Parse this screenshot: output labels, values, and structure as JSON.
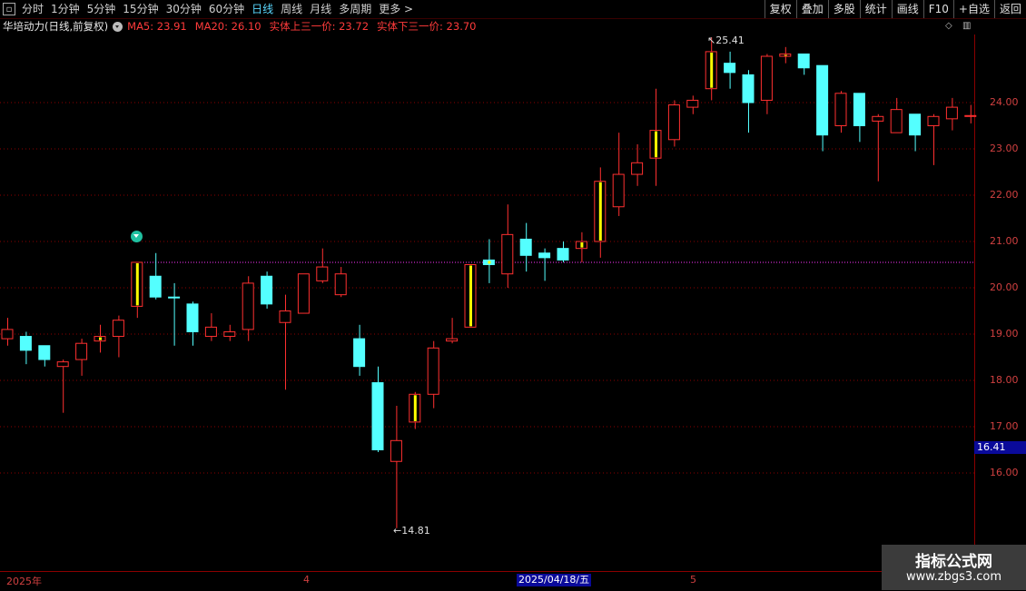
{
  "toolbar": {
    "periods": [
      "分时",
      "1分钟",
      "5分钟",
      "15分钟",
      "30分钟",
      "60分钟",
      "日线",
      "周线",
      "月线",
      "多周期",
      "更多 >"
    ],
    "active_period": "日线",
    "right_buttons": [
      "复权",
      "叠加",
      "多股",
      "统计",
      "画线",
      "F10",
      "+自选",
      "返回"
    ]
  },
  "info": {
    "stock_title": "华培动力(日线,前复权)",
    "indicators": [
      "MA5: 23.91",
      "MA20: 26.10",
      "实体上三一价: 23.72",
      "实体下三一价: 23.70"
    ]
  },
  "price_axis": {
    "labels": [
      "24.00",
      "23.00",
      "22.00",
      "21.00",
      "20.00",
      "19.00",
      "18.00",
      "17.00",
      "16.00"
    ],
    "current_price": "16.41"
  },
  "date_axis": {
    "labels": [
      "2025年",
      "4",
      "5"
    ],
    "selected": "2025/04/18/五"
  },
  "annotations": {
    "high": "25.41",
    "low": "14.81"
  },
  "watermark": {
    "line1": "指标公式网",
    "line2": "www.zbgs3.com"
  },
  "colors": {
    "up": "#ff3030",
    "down": "#54ffff",
    "highlight": "#ffff00",
    "grid": "#8b0000",
    "ref": "#ff33ff"
  },
  "chart_data": {
    "type": "candlestick",
    "ylim": [
      14.5,
      25.9
    ],
    "reference_line": 20.55,
    "candles": [
      {
        "o": 18.9,
        "h": 19.35,
        "l": 18.75,
        "c": 19.1,
        "k": "up"
      },
      {
        "o": 18.95,
        "h": 19.05,
        "l": 18.35,
        "c": 18.65,
        "k": "down"
      },
      {
        "o": 18.75,
        "h": 18.75,
        "l": 18.3,
        "c": 18.45,
        "k": "down"
      },
      {
        "o": 18.3,
        "h": 18.45,
        "l": 17.3,
        "c": 18.4,
        "k": "up"
      },
      {
        "o": 18.45,
        "h": 18.9,
        "l": 18.1,
        "c": 18.8,
        "k": "up"
      },
      {
        "o": 18.85,
        "h": 19.2,
        "l": 18.6,
        "c": 18.95,
        "k": "up",
        "hi": true
      },
      {
        "o": 18.95,
        "h": 19.4,
        "l": 18.5,
        "c": 19.3,
        "k": "up"
      },
      {
        "o": 19.6,
        "h": 20.55,
        "l": 19.35,
        "c": 20.55,
        "k": "up",
        "hi": true
      },
      {
        "o": 20.25,
        "h": 20.75,
        "l": 19.75,
        "c": 19.8,
        "k": "down"
      },
      {
        "o": 19.8,
        "h": 20.1,
        "l": 18.75,
        "c": 19.8,
        "k": "down"
      },
      {
        "o": 19.65,
        "h": 19.7,
        "l": 18.75,
        "c": 19.05,
        "k": "down"
      },
      {
        "o": 18.95,
        "h": 19.45,
        "l": 18.85,
        "c": 19.15,
        "k": "up"
      },
      {
        "o": 18.95,
        "h": 19.2,
        "l": 18.85,
        "c": 19.05,
        "k": "up"
      },
      {
        "o": 19.1,
        "h": 20.25,
        "l": 18.85,
        "c": 20.1,
        "k": "up"
      },
      {
        "o": 20.25,
        "h": 20.35,
        "l": 19.55,
        "c": 19.65,
        "k": "down"
      },
      {
        "o": 19.25,
        "h": 19.85,
        "l": 17.8,
        "c": 19.5,
        "k": "up"
      },
      {
        "o": 19.45,
        "h": 20.3,
        "l": 19.45,
        "c": 20.3,
        "k": "up"
      },
      {
        "o": 20.15,
        "h": 20.85,
        "l": 20.1,
        "c": 20.45,
        "k": "up"
      },
      {
        "o": 19.85,
        "h": 20.45,
        "l": 19.8,
        "c": 20.3,
        "k": "up"
      },
      {
        "o": 18.9,
        "h": 19.2,
        "l": 18.1,
        "c": 18.3,
        "k": "down"
      },
      {
        "o": 17.95,
        "h": 18.3,
        "l": 16.45,
        "c": 16.5,
        "k": "down"
      },
      {
        "o": 16.25,
        "h": 17.45,
        "l": 14.81,
        "c": 16.7,
        "k": "up"
      },
      {
        "o": 17.1,
        "h": 17.75,
        "l": 16.95,
        "c": 17.7,
        "k": "up",
        "hi": true
      },
      {
        "o": 17.7,
        "h": 18.85,
        "l": 17.4,
        "c": 18.7,
        "k": "up"
      },
      {
        "o": 18.85,
        "h": 19.35,
        "l": 18.8,
        "c": 18.9,
        "k": "up"
      },
      {
        "o": 19.15,
        "h": 20.5,
        "l": 19.15,
        "c": 20.5,
        "k": "up",
        "hi": true
      },
      {
        "o": 20.6,
        "h": 21.05,
        "l": 20.1,
        "c": 20.5,
        "k": "down",
        "hi": true
      },
      {
        "o": 20.3,
        "h": 21.8,
        "l": 20.0,
        "c": 21.15,
        "k": "up"
      },
      {
        "o": 21.05,
        "h": 21.4,
        "l": 20.35,
        "c": 20.7,
        "k": "down"
      },
      {
        "o": 20.75,
        "h": 20.85,
        "l": 20.15,
        "c": 20.65,
        "k": "down"
      },
      {
        "o": 20.85,
        "h": 21.0,
        "l": 20.55,
        "c": 20.6,
        "k": "down"
      },
      {
        "o": 20.85,
        "h": 21.2,
        "l": 20.55,
        "c": 21.0,
        "k": "up",
        "hi": true
      },
      {
        "o": 21.0,
        "h": 22.6,
        "l": 20.65,
        "c": 22.3,
        "k": "up",
        "hi": true
      },
      {
        "o": 21.75,
        "h": 23.35,
        "l": 21.55,
        "c": 22.45,
        "k": "up"
      },
      {
        "o": 22.45,
        "h": 23.1,
        "l": 22.2,
        "c": 22.7,
        "k": "up"
      },
      {
        "o": 22.8,
        "h": 24.3,
        "l": 22.2,
        "c": 23.4,
        "k": "up",
        "hi": true
      },
      {
        "o": 23.2,
        "h": 24.05,
        "l": 23.05,
        "c": 23.95,
        "k": "up"
      },
      {
        "o": 23.9,
        "h": 24.15,
        "l": 23.75,
        "c": 24.05,
        "k": "up"
      },
      {
        "o": 24.3,
        "h": 25.41,
        "l": 24.05,
        "c": 25.1,
        "k": "up",
        "hi": true
      },
      {
        "o": 24.85,
        "h": 25.1,
        "l": 24.3,
        "c": 24.65,
        "k": "down"
      },
      {
        "o": 24.6,
        "h": 24.7,
        "l": 23.35,
        "c": 24.0,
        "k": "down"
      },
      {
        "o": 24.05,
        "h": 25.05,
        "l": 23.75,
        "c": 25.0,
        "k": "up"
      },
      {
        "o": 25.0,
        "h": 25.2,
        "l": 24.85,
        "c": 25.05,
        "k": "up",
        "hi": true
      },
      {
        "o": 25.05,
        "h": 25.05,
        "l": 24.6,
        "c": 24.75,
        "k": "down"
      },
      {
        "o": 24.8,
        "h": 24.8,
        "l": 22.95,
        "c": 23.3,
        "k": "down"
      },
      {
        "o": 23.5,
        "h": 24.25,
        "l": 23.35,
        "c": 24.2,
        "k": "up"
      },
      {
        "o": 24.2,
        "h": 24.2,
        "l": 23.15,
        "c": 23.5,
        "k": "down"
      },
      {
        "o": 23.6,
        "h": 23.75,
        "l": 22.3,
        "c": 23.7,
        "k": "up"
      },
      {
        "o": 23.35,
        "h": 24.1,
        "l": 23.35,
        "c": 23.85,
        "k": "up"
      },
      {
        "o": 23.75,
        "h": 23.75,
        "l": 22.95,
        "c": 23.3,
        "k": "down"
      },
      {
        "o": 23.5,
        "h": 23.75,
        "l": 22.65,
        "c": 23.7,
        "k": "up"
      },
      {
        "o": 23.65,
        "h": 24.1,
        "l": 23.4,
        "c": 23.9,
        "k": "up"
      },
      {
        "o": 23.72,
        "h": 23.95,
        "l": 23.55,
        "c": 23.7,
        "k": "up"
      }
    ]
  }
}
